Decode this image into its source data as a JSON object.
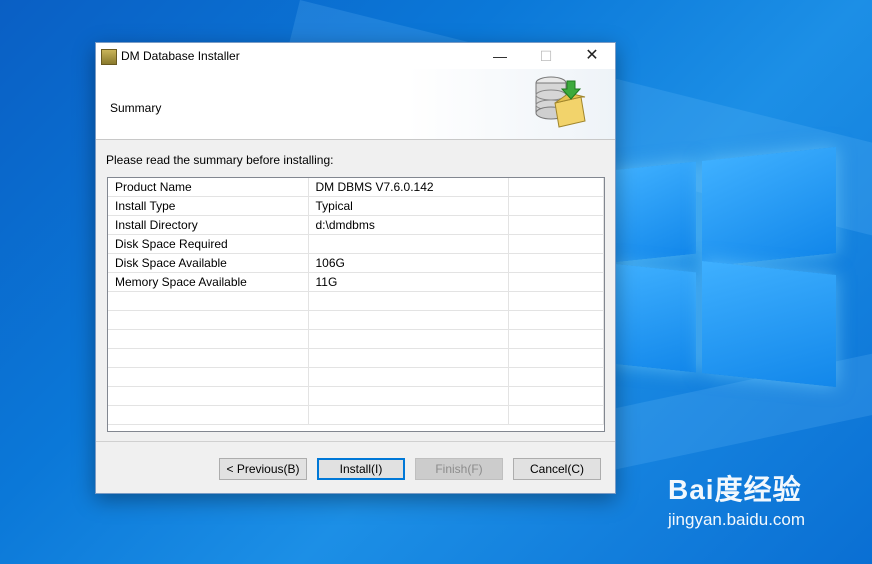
{
  "window": {
    "title": "DM Database Installer",
    "controls": {
      "minimize": "—",
      "maximize": "☐",
      "close": "✕"
    }
  },
  "header": {
    "title": "Summary"
  },
  "body": {
    "prompt": "Please read the summary before installing:"
  },
  "summary_table": {
    "rows": [
      [
        "Product Name",
        "DM DBMS V7.6.0.142",
        ""
      ],
      [
        "Install Type",
        "Typical",
        ""
      ],
      [
        "Install Directory",
        "d:\\dmdbms",
        ""
      ],
      [
        "Disk Space Required",
        "",
        ""
      ],
      [
        "Disk Space Available",
        "106G",
        ""
      ],
      [
        "Memory Space Available",
        "11G",
        ""
      ],
      [
        "",
        "",
        ""
      ],
      [
        "",
        "",
        ""
      ],
      [
        "",
        "",
        ""
      ],
      [
        "",
        "",
        ""
      ],
      [
        "",
        "",
        ""
      ],
      [
        "",
        "",
        ""
      ],
      [
        "",
        "",
        ""
      ]
    ]
  },
  "buttons": {
    "previous": "< Previous(B)",
    "install": "Install(I)",
    "finish": "Finish(F)",
    "cancel": "Cancel(C)"
  },
  "watermark": {
    "logo": "Bai度经验",
    "url": "jingyan.baidu.com"
  },
  "colors": {
    "accent": "#0078d7",
    "desktop": "#0b78d8"
  }
}
